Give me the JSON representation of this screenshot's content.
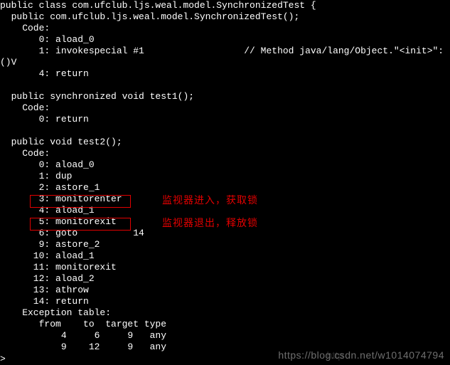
{
  "lines": [
    "public class com.ufclub.ljs.weal.model.SynchronizedTest {",
    "  public com.ufclub.ljs.weal.model.SynchronizedTest();",
    "    Code:",
    "       0: aload_0",
    "       1: invokespecial #1                  // Method java/lang/Object.\"<init>\":",
    "()V",
    "       4: return",
    "",
    "  public synchronized void test1();",
    "    Code:",
    "       0: return",
    "",
    "  public void test2();",
    "    Code:",
    "       0: aload_0",
    "       1: dup",
    "       2: astore_1",
    "       3: monitorenter",
    "       4: aload_1",
    "       5: monitorexit",
    "       6: goto          14",
    "       9: astore_2",
    "      10: aload_1",
    "      11: monitorexit",
    "      12: aload_2",
    "      13: athrow",
    "      14: return",
    "    Exception table:",
    "       from    to  target type",
    "           4     6     9   any",
    "           9    12     9   any"
  ],
  "annotations": {
    "enter": "监视器进入，获取锁",
    "exit": "监视器退出，释放锁"
  },
  "watermark": "https://blog.csdn.net/w1014074794",
  "watermark_ghost": "http"
}
